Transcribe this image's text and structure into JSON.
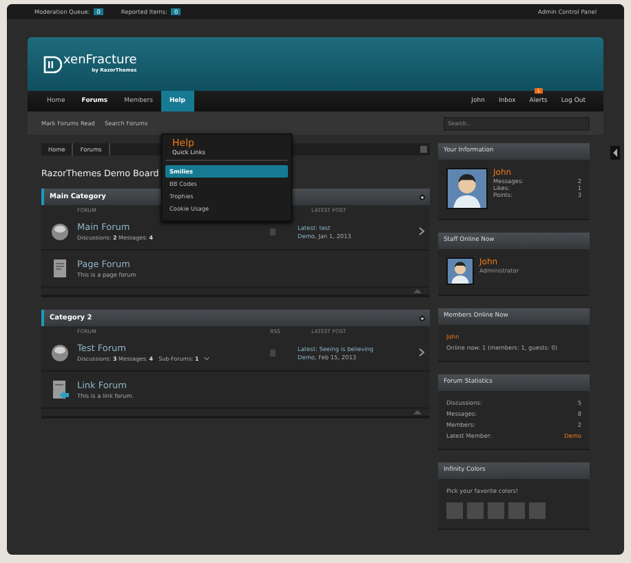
{
  "top_bar": {
    "links": [
      {
        "label": "Moderation Queue:",
        "count": "0"
      },
      {
        "label": "Reported Items:",
        "count": "0"
      }
    ],
    "admin_link": "Admin Control Panel"
  },
  "logo": {
    "name": "xenFracture",
    "tagline": "by RazorThemes"
  },
  "nav": {
    "tabs": [
      {
        "label": "Home",
        "selected": false,
        "open": false
      },
      {
        "label": "Forums",
        "selected": true,
        "open": false
      },
      {
        "label": "Members",
        "selected": false,
        "open": false
      },
      {
        "label": "Help",
        "selected": false,
        "open": true
      }
    ],
    "user_links": [
      {
        "label": "John"
      },
      {
        "label": "Inbox"
      },
      {
        "label": "Alerts",
        "badge": "1"
      },
      {
        "label": "Log Out"
      }
    ]
  },
  "sub_nav": {
    "links": [
      "Mark Forums Read",
      "Search Forums"
    ],
    "search": {
      "placeholder": "Search..."
    }
  },
  "dropdown": {
    "title": "Help",
    "subtitle": "Quick Links",
    "items": [
      {
        "label": "Smilies",
        "selected": true
      },
      {
        "label": "BB Codes",
        "selected": false
      },
      {
        "label": "Trophies",
        "selected": false
      },
      {
        "label": "Cookie Usage",
        "selected": false
      }
    ]
  },
  "breadcrumb": [
    "Home",
    "Forums"
  ],
  "page_title": "RazorThemes Demo Board",
  "categories": [
    {
      "title": "Main Category",
      "columns": [
        "FORUM",
        "",
        "LATEST POST"
      ],
      "forums": [
        {
          "kind": "forum",
          "title": "Main Forum",
          "stats": "Discussions: **2** Messages: **4**",
          "latest": "Latest: test",
          "latest_user": "Demo",
          "latest_date": ", Jan 1, 2013"
        },
        {
          "kind": "page",
          "title": "Page Forum",
          "description": "This is a page forum"
        }
      ]
    },
    {
      "title": "Category 2",
      "columns": [
        "FORUM",
        "RSS",
        "LATEST POST"
      ],
      "forums": [
        {
          "kind": "forum",
          "title": "Test Forum",
          "stats": "Discussions: **3** Messages: **4**",
          "sub_forums": "Sub-Forums: **1**",
          "latest": "Latest: Seeing is believing",
          "latest_user": "Demo",
          "latest_date": ", Feb 15, 2013"
        },
        {
          "kind": "link",
          "title": "Link Forum",
          "description": "This is a link forum."
        }
      ]
    }
  ],
  "sidebar": [
    {
      "kind": "user_info",
      "title": "Your Information",
      "name": "John",
      "stats": [
        [
          "Messages:",
          "2"
        ],
        [
          "Likes:",
          "1"
        ],
        [
          "Points:",
          "3"
        ]
      ]
    },
    {
      "kind": "staff",
      "title": "Staff Online Now",
      "name": "John",
      "role": "Administrator"
    },
    {
      "kind": "members",
      "title": "Members Online Now",
      "name": "John",
      "text": "Online now: 1 (members: 1, guests: 0)"
    },
    {
      "kind": "stats",
      "title": "Forum Statistics",
      "stats": [
        [
          "Discussions:",
          "5"
        ],
        [
          "Messages:",
          "8"
        ],
        [
          "Members:",
          "2"
        ],
        [
          "Latest Member:",
          "Demo"
        ]
      ]
    },
    {
      "kind": "colors",
      "title": "Infinity Colors",
      "text": "Pick your favorite colors!"
    }
  ]
}
